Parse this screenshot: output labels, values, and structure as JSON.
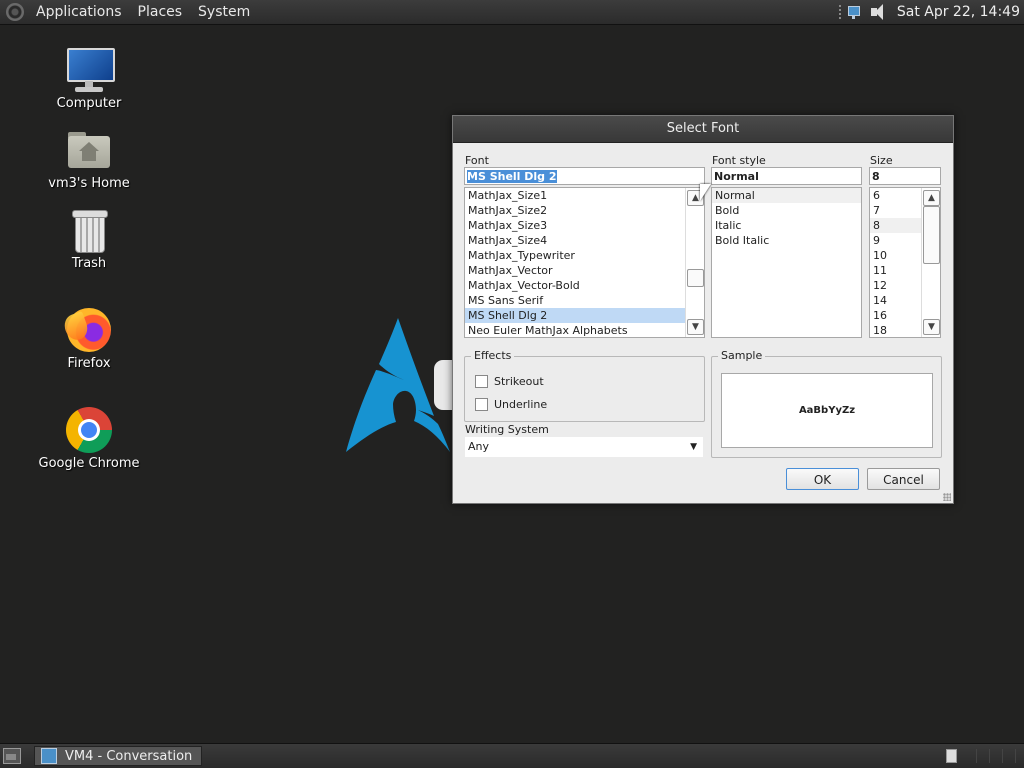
{
  "top_panel": {
    "menus": [
      "Applications",
      "Places",
      "System"
    ],
    "clock": "Sat Apr 22, 14:49"
  },
  "desktop_icons": [
    {
      "label": "Computer",
      "icon": "computer-icon"
    },
    {
      "label": "vm3's Home",
      "icon": "home-folder-icon"
    },
    {
      "label": "Trash",
      "icon": "trash-icon"
    },
    {
      "label": "Firefox",
      "icon": "firefox-icon"
    },
    {
      "label": "Google Chrome",
      "icon": "chrome-icon"
    }
  ],
  "dialog": {
    "title": "Select Font",
    "font": {
      "label": "Font",
      "value": "MS Shell Dlg 2",
      "items": [
        "MathJax_Size1",
        "MathJax_Size2",
        "MathJax_Size3",
        "MathJax_Size4",
        "MathJax_Typewriter",
        "MathJax_Vector",
        "MathJax_Vector-Bold",
        "MS Sans Serif",
        "MS Shell Dlg 2",
        "Neo Euler MathJax Alphabets"
      ],
      "selected": "MS Shell Dlg 2"
    },
    "font_style": {
      "label": "Font style",
      "value": "Normal",
      "items": [
        "Normal",
        "Bold",
        "Italic",
        "Bold Italic"
      ],
      "selected": "Normal"
    },
    "size": {
      "label": "Size",
      "value": "8",
      "items": [
        "6",
        "7",
        "8",
        "9",
        "10",
        "11",
        "12",
        "14",
        "16",
        "18"
      ],
      "selected": "8"
    },
    "effects": {
      "title": "Effects",
      "strikeout": {
        "label": "Strikeout",
        "checked": false
      },
      "underline": {
        "label": "Underline",
        "checked": false
      }
    },
    "sample": {
      "title": "Sample",
      "text": "AaBbYyZz"
    },
    "writing_system": {
      "label": "Writing System",
      "value": "Any"
    },
    "buttons": {
      "ok": "OK",
      "cancel": "Cancel"
    }
  },
  "taskbar": {
    "window_title": "VM4 - Conversation"
  },
  "colors": {
    "desktop_bg": "#222221",
    "arch_blue": "#1793d1",
    "selection_blue": "#4a8fd8",
    "list_selection": "#bfd9f5"
  }
}
